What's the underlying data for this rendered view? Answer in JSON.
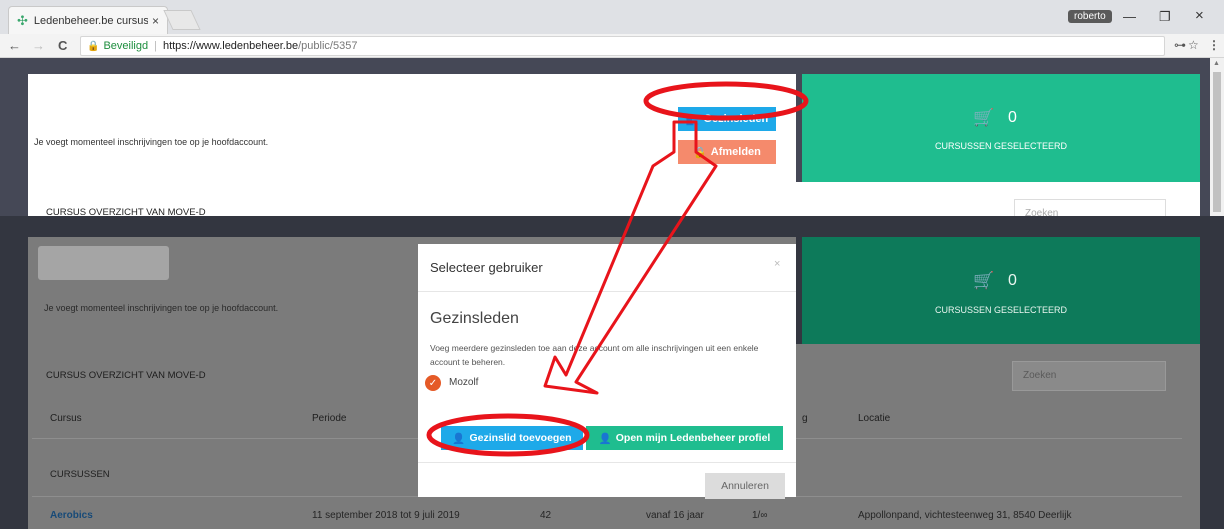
{
  "browser": {
    "tab_title": "Ledenbeheer.be cursuso",
    "tab_close": "×",
    "user_chip": "roberto",
    "secure_label": "Beveiligd",
    "url_host": "https://www.ledenbeheer.be",
    "url_path": "/public/5357",
    "nav_back": "←",
    "nav_forward": "→",
    "nav_reload": "C",
    "win_min": "—",
    "win_max": "❐",
    "win_close": "×",
    "key_icon": "⊶",
    "star_icon": "☆",
    "menu_icon": "⋮"
  },
  "top": {
    "info_text": "Je voegt momenteel inschrijvingen toe op je hoofdaccount.",
    "gezinsleden_button": "Gezinsleden",
    "afmelden_button": "Afmelden",
    "cart_count": "0",
    "cart_label": "CURSUSSEN GESELECTEERD",
    "overview_title": "CURSUS OVERZICHT VAN MOVE-D",
    "search_placeholder": "Zoeken"
  },
  "bottom": {
    "info_text": "Je voegt momenteel inschrijvingen toe op je hoofdaccount.",
    "cart_count": "0",
    "cart_label": "CURSUSSEN GESELECTEERD",
    "overview_title": "CURSUS OVERZICHT VAN MOVE-D",
    "search_placeholder": "Zoeken",
    "columns": {
      "cursus": "Cursus",
      "periode": "Periode",
      "leeftijd_fragment": "g",
      "locatie": "Locatie"
    },
    "section_label": "CURSUSSEN",
    "row": {
      "name": "Aerobics",
      "periode": "11 september 2018 tot 9 juli 2019",
      "count": "42",
      "age": "vanaf 16 jaar",
      "extra": "1/∞",
      "locatie": "Appollonpand, vichtesteenweg 31, 8540 Deerlijk"
    }
  },
  "modal": {
    "title": "Selecteer gebruiker",
    "close": "×",
    "heading": "Gezinsleden",
    "description": "Voeg meerdere gezinsleden toe aan deze account om alle inschrijvingen uit een enkele account te beheren.",
    "member": "Mozolf",
    "add_button": "Gezinslid toevoegen",
    "profile_button": "Open mijn Ledenbeheer profiel",
    "cancel_button": "Annuleren"
  },
  "colors": {
    "accent_blue": "#1ea9e9",
    "accent_green": "#1fbd8f",
    "salmon": "#f58a6c",
    "annotation_red": "#e8141b"
  }
}
